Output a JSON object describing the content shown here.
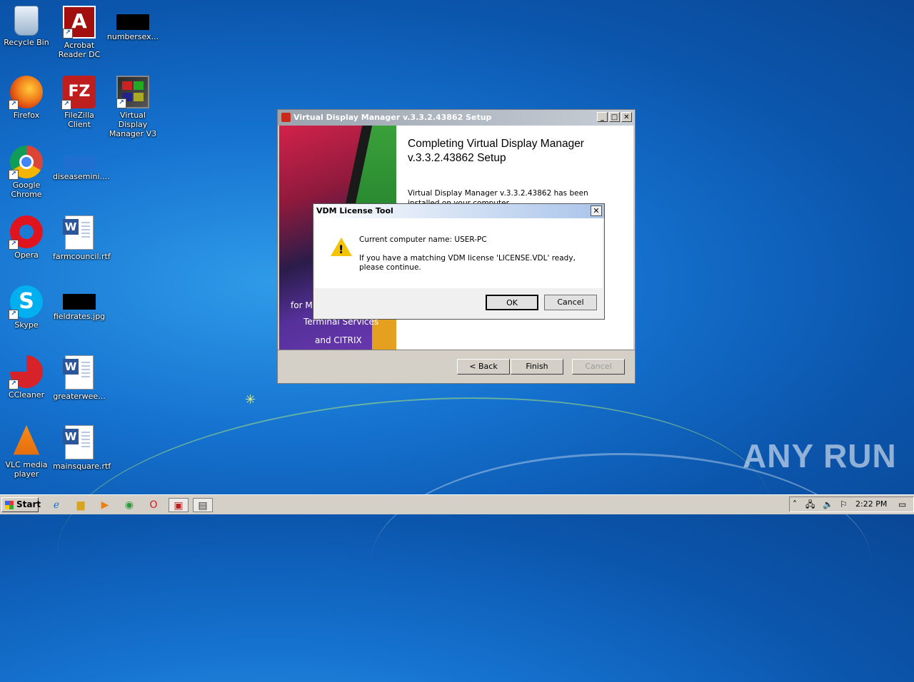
{
  "desktop": {
    "icons": [
      {
        "label": "Recycle Bin"
      },
      {
        "label": "Acrobat Reader DC"
      },
      {
        "label": "numbersex..."
      },
      {
        "label": "Firefox"
      },
      {
        "label": "FileZilla Client"
      },
      {
        "label": "Virtual Display Manager V3"
      },
      {
        "label": "Google Chrome"
      },
      {
        "label": "diseasemini...."
      },
      {
        "label": "Opera"
      },
      {
        "label": "farmcouncil.rtf"
      },
      {
        "label": "Skype"
      },
      {
        "label": "fieldrates.jpg"
      },
      {
        "label": "CCleaner"
      },
      {
        "label": "greaterwee..."
      },
      {
        "label": "VLC media player"
      },
      {
        "label": "mainsquare.rtf"
      }
    ]
  },
  "installer": {
    "title": "Virtual Display Manager v.3.3.2.43862 Setup",
    "heading": "Completing Virtual Display Manager v.3.3.2.43862 Setup",
    "body": "Virtual Display Manager v.3.3.2.43862 has been installed on your computer.",
    "banner_line1": "for M",
    "banner_line2": "Terminal Services",
    "banner_line3": "and CITRIX",
    "back_label": "< Back",
    "finish_label": "Finish",
    "cancel_label": "Cancel"
  },
  "license_dialog": {
    "title": "VDM License Tool",
    "line1": "Current computer name: USER-PC",
    "line2": "If you have a matching VDM license 'LICENSE.VDL' ready, please continue.",
    "ok_label": "OK",
    "cancel_label": "Cancel"
  },
  "taskbar": {
    "start_label": "Start",
    "time": "2:22 PM"
  },
  "watermark": "ANY RUN"
}
